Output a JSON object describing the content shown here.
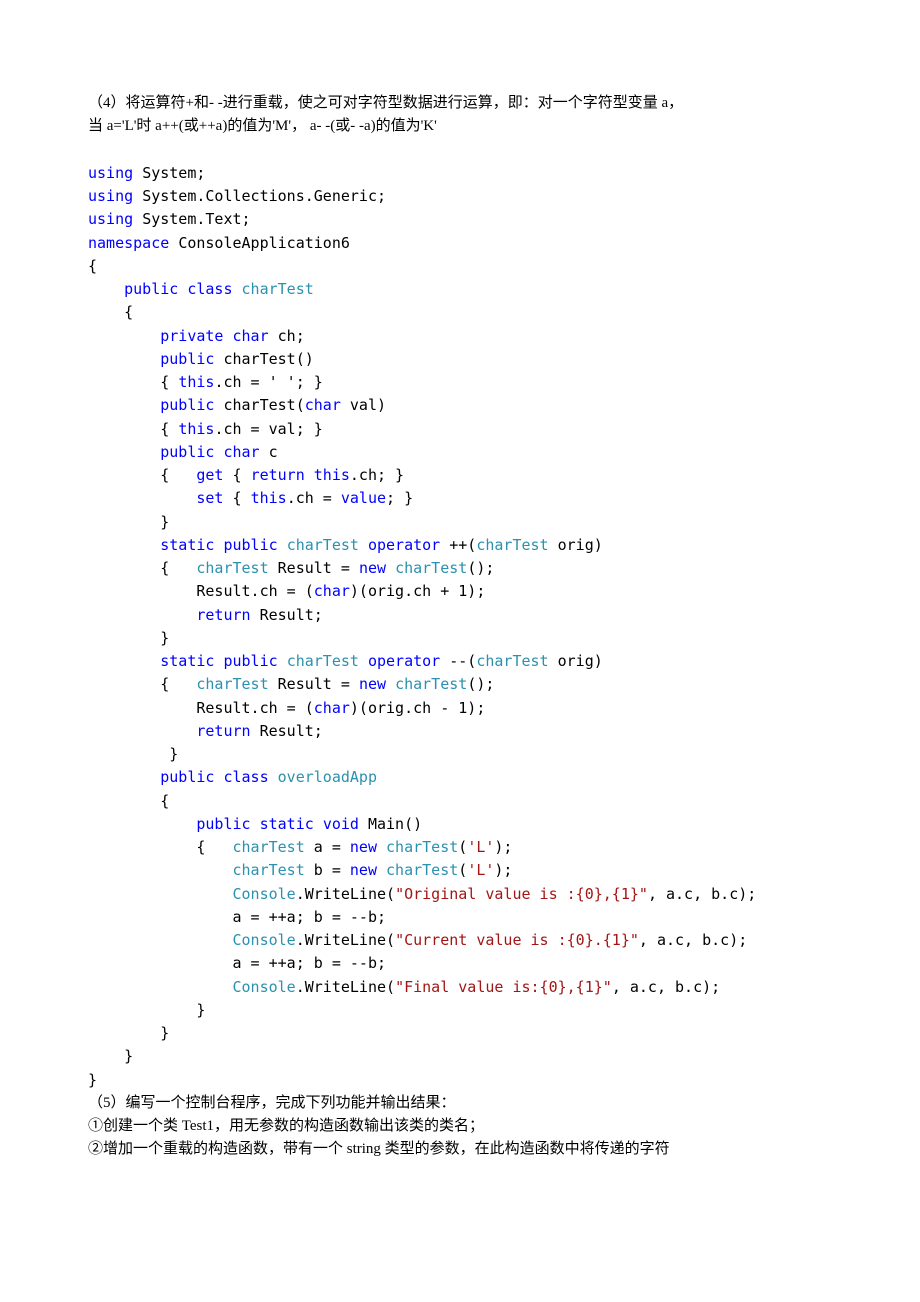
{
  "q4": {
    "title_l1": "（4）将运算符+和- -进行重载，使之可对字符型数据进行运算，即：对一个字符型变量 a，",
    "title_l2": "当 a='L'时 a++(或++a)的值为'M'， a- -(或- -a)的值为'K'",
    "using1": "System;",
    "using2": "System.Collections.Generic;",
    "using3": "System.Text;",
    "ns": "ConsoleApplication6",
    "cls1": "charTest",
    "kw_using": "using",
    "kw_namespace": "namespace",
    "kw_public": "public",
    "kw_class": "class",
    "kw_private": "private",
    "kw_char": "char",
    "kw_this": "this",
    "kw_get": "get",
    "kw_return": "return",
    "kw_set": "set",
    "kw_value": "value",
    "kw_static": "static",
    "kw_operator": "operator",
    "kw_new": "new",
    "kw_void": "void",
    "field": " ch;",
    "ctor0_sig": " charTest()",
    "ctor0_body_a": "{ ",
    "ctor0_body_b": ".ch = ' '; }",
    "ctor1_sig_a": " charTest(",
    "ctor1_sig_b": " val)",
    "ctor1_body_a": "{ ",
    "ctor1_body_b": ".ch = val; }",
    "prop_sig": " c",
    "prop_get_a": "{   ",
    "prop_get_b": " { ",
    "prop_get_c": ".ch; }",
    "prop_set_a": " { ",
    "prop_set_b": ".ch = ",
    "prop_set_c": "; }",
    "brace_close": "}",
    "op_inc_sig_a": " ++(",
    "op_inc_sig_b": " orig)",
    "op_body_open": "{   ",
    "op_res_decl": " Result = ",
    "op_res_new": "();",
    "op_inc_assign_a": "    Result.ch = (",
    "op_inc_assign_b": ")(orig.ch + 1);",
    "op_dec_sig_a": " --(",
    "op_dec_sig_b": " orig)",
    "op_dec_assign_a": "    Result.ch = (",
    "op_dec_assign_b": ")(orig.ch - 1);",
    "op_ret_a": "    ",
    "op_ret_b": " Result;",
    "op_close": " }",
    "cls2": "overloadApp",
    "main_sig": " Main()",
    "main_open": "{   ",
    "main_a_a": " a = ",
    "main_a_b": "('L');",
    "main_a_arg": "'L'",
    "main_b_a": " b = ",
    "main_b_b": "('L');",
    "main_c_pre": "    ",
    "main_c_obj": "Console",
    "main_c_dot": ".WriteLine(",
    "str1": "\"Original value is :{0},{1}\"",
    "main_c_tail": ", a.c, b.c);",
    "main_ab1": "    a = ++a; b = --b;",
    "str2": "\"Current value is :{0}.{1}\"",
    "main_ab2": "    a = ++a; b = --b;",
    "str3": "\"Final value is:{0},{1}\""
  },
  "q5": {
    "title": "（5）编写一个控制台程序，完成下列功能并输出结果：",
    "li1": "①创建一个类 Test1，用无参数的构造函数输出该类的类名；",
    "li2": "②增加一个重载的构造函数，带有一个 string 类型的参数，在此构造函数中将传递的字符"
  }
}
